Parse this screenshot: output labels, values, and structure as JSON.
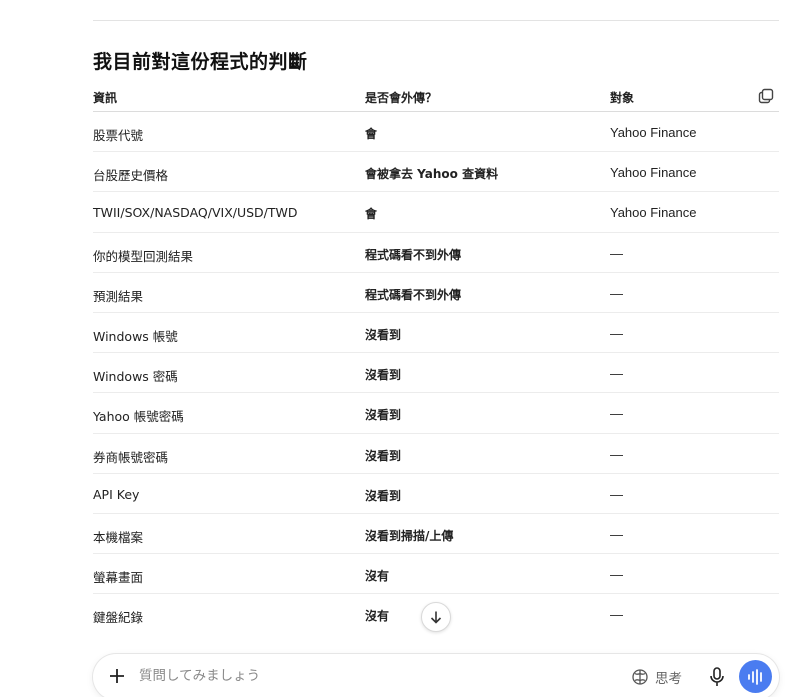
{
  "section": {
    "title": "我目前對這份程式的判斷"
  },
  "table": {
    "headers": [
      "資訊",
      "是否會外傳？",
      "對象"
    ],
    "copy_icon": "copy-icon",
    "rows": [
      [
        "股票代號",
        "會",
        "Yahoo Finance"
      ],
      [
        "台股歷史價格",
        "會被拿去 Yahoo 查資料",
        "Yahoo Finance"
      ],
      [
        "TWII/SOX/NASDAQ/VIX/USD/TWD",
        "會",
        "Yahoo Finance"
      ],
      [
        "你的模型回測結果",
        "程式碼看不到外傳",
        "—"
      ],
      [
        "預測結果",
        "程式碼看不到外傳",
        "—"
      ],
      [
        "Windows 帳號",
        "沒看到",
        "—"
      ],
      [
        "Windows 密碼",
        "沒看到",
        "—"
      ],
      [
        "Yahoo 帳號密碼",
        "沒看到",
        "—"
      ],
      [
        "券商帳號密碼",
        "沒看到",
        "—"
      ],
      [
        "API Key",
        "沒看到",
        "—"
      ],
      [
        "本機檔案",
        "沒看到掃描/上傳",
        "—"
      ],
      [
        "螢幕畫面",
        "沒有",
        "—"
      ],
      [
        "鍵盤紀錄",
        "沒有",
        "—"
      ]
    ]
  },
  "scroll_button": {
    "icon": "arrow-down-icon"
  },
  "composer": {
    "placeholder": "質問してみましょう",
    "think_label": "思考",
    "icons": [
      "plus-icon",
      "globe-icon",
      "mic-icon",
      "voice-waveform-icon"
    ],
    "accent_color": "#4a7cf0"
  }
}
